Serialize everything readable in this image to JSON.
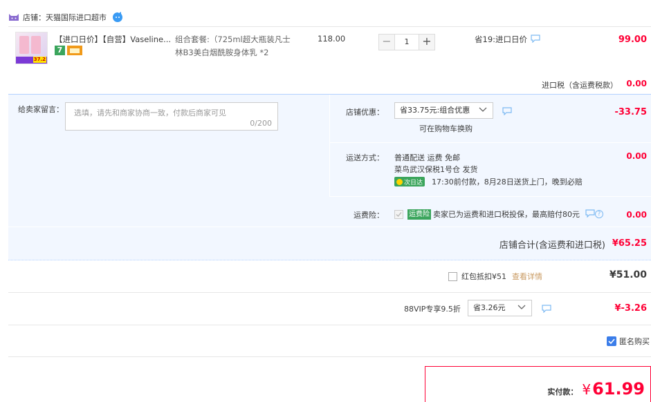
{
  "shop": {
    "label": "店铺：天猫国际进口超市",
    "icon": "tmall-cat-icon",
    "chat_icon": "wangwang-chat-icon"
  },
  "item": {
    "title": "【进口日价】【自营】Vaseline...",
    "spec": "组合套餐:（725ml超大瓶装凡士林B3美白烟酰胺身体乳 *2",
    "price": "118.00",
    "qty": "1",
    "save": "省19:进口日价",
    "subtotal": "99.00",
    "thumb_badge": "37.2",
    "badge_seven": "7",
    "badge_card": "card-icon"
  },
  "tax": {
    "label": "进口税（含运费税款）",
    "value": "0.00"
  },
  "message": {
    "label": "给卖家留言：",
    "placeholder": "选填，请先和商家协商一致，付款后商家可见",
    "counter": "0/200"
  },
  "discount": {
    "label": "店铺优惠：",
    "selected": "省33.75元:组合优惠",
    "hint": "可在购物车换购",
    "value": "-33.75"
  },
  "shipping": {
    "label": "运送方式：",
    "line1": "普通配送 运费 免邮",
    "line2": "菜鸟武汉保税1号仓  发货",
    "badge": "次日达",
    "line3": "17:30前付款，8月28日送货上门，晚到必赔",
    "value": "0.00"
  },
  "insurance": {
    "label": "运费险：",
    "badge": "运费险",
    "text": "卖家已为运费和进口税投保，最高赔付80元",
    "value": "0.00"
  },
  "store_total": {
    "label": "店铺合计(含运费和进口税)",
    "value": "¥65.25"
  },
  "redpacket": {
    "label": "红包抵扣¥51",
    "link": "查看详情",
    "value": "¥51.00"
  },
  "vip": {
    "label": "88VIP专享9.5折",
    "selected": "省3.26元",
    "value": "¥-3.26"
  },
  "anonymous": {
    "label": "匿名购买"
  },
  "payment": {
    "label": "实付款：",
    "currency": "¥",
    "amount": "61.99"
  },
  "colors": {
    "accent": "#ff0036",
    "blue_bg": "#f2f7ff",
    "border_blue": "#b2d1ff",
    "green": "#3ba55c",
    "check": "#3b7de9"
  }
}
